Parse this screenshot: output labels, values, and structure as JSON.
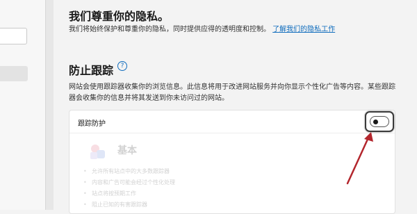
{
  "privacy": {
    "title": "我们尊重你的隐私。",
    "description": "我们将始终保护和尊重你的隐私，同时提供应得的透明度和控制。",
    "learn_more_link": "了解我们的隐私工作"
  },
  "tracking_prevention": {
    "heading": "防止跟踪",
    "help_icon": "?",
    "description": "网站会使用跟踪器收集你的浏览信息。此信息将用于改进网站服务并向你显示个性化广告等内容。某些跟踪器会收集你的信息并将其发送到你未访问过的网站。",
    "card": {
      "title": "跟踪防护",
      "toggle_state": "on",
      "options": [
        {
          "title": "基本",
          "items": [
            "允许所有站点中的大多数跟踪器",
            "内容和广告可能会经过个性化处理",
            "站点将按预期工作",
            "阻止已知的有害跟踪器"
          ]
        }
      ]
    }
  },
  "annotation": {
    "arrow_color": "#b3262d",
    "target": "tracking-prevention-toggle"
  },
  "colors": {
    "accent": "#0f6cbd",
    "background": "#f3f3f3",
    "card": "#ffffff"
  }
}
